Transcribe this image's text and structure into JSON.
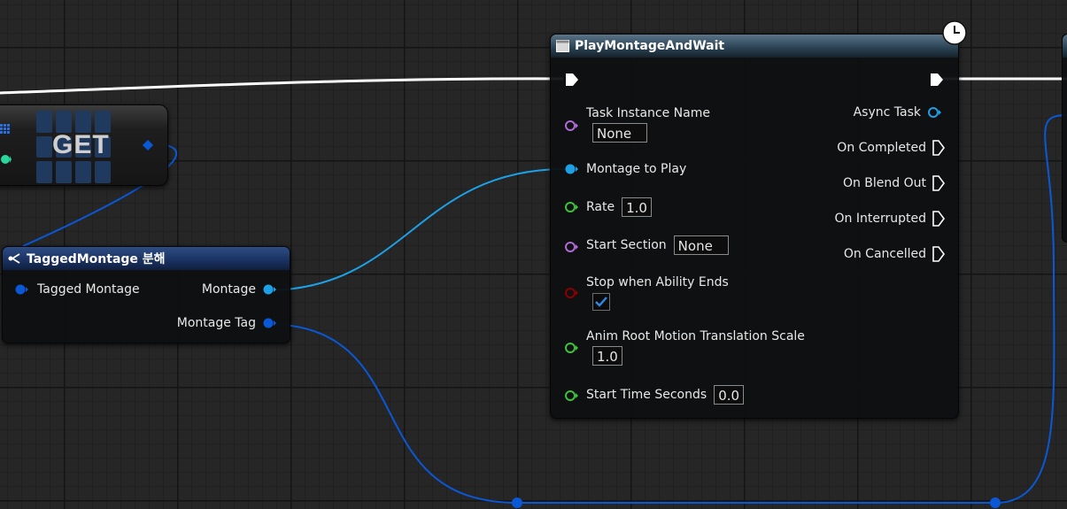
{
  "get_node": {
    "label": "GET"
  },
  "tagged_montage_node": {
    "title": "TaggedMontage 분해",
    "input_pin": "Tagged Montage",
    "output_pins": [
      "Montage",
      "Montage Tag"
    ]
  },
  "play_montage_node": {
    "title": "PlayMontageAndWait",
    "inputs": {
      "task_instance_name": {
        "label": "Task Instance Name",
        "value": "None"
      },
      "montage_to_play": {
        "label": "Montage to Play"
      },
      "rate": {
        "label": "Rate",
        "value": "1.0"
      },
      "start_section": {
        "label": "Start Section",
        "value": "None"
      },
      "stop_when_ability_ends": {
        "label": "Stop when Ability Ends",
        "checked": true
      },
      "anim_root_motion_translation_scale": {
        "label": "Anim Root Motion Translation Scale",
        "value": "1.0"
      },
      "start_time_seconds": {
        "label": "Start Time Seconds",
        "value": "0.0"
      }
    },
    "outputs": [
      "Async Task",
      "On Completed",
      "On Blend Out",
      "On Interrupted",
      "On Cancelled"
    ]
  },
  "colors": {
    "exec_wire": "#ffffff",
    "object_pin": "#1ea0e6",
    "struct_pin": "#0a58d6",
    "name_pin": "#b06ad8",
    "float_pin": "#3cc33c",
    "bool_pin": "#8a0000",
    "async_pin": "#1ea0e6",
    "get_output_pin": "#2ad69c"
  }
}
